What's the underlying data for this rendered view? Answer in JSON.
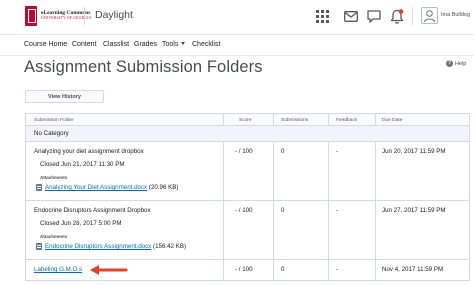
{
  "header": {
    "logo_line1": "eLearning Commons",
    "logo_line2": "UNIVERSITY OF GEORGIA",
    "org_title": "Daylight",
    "user_name": "Ima Bulldog",
    "icons": [
      "apps-grid-icon",
      "mail-icon",
      "chat-icon",
      "bell-icon",
      "user-avatar"
    ]
  },
  "nav": {
    "items": [
      "Course Home",
      "Content",
      "Classlist",
      "Grades",
      "Tools",
      "Checklist"
    ]
  },
  "page": {
    "title": "Assignment Submission Folders",
    "help_label": "Help",
    "view_history_label": "View History"
  },
  "table": {
    "headers": [
      "Submission Folder",
      "Score",
      "Submissions",
      "Feedback",
      "Due Date"
    ],
    "category": "No Category",
    "attachments_label": "Attachments",
    "rows": [
      {
        "name": "Analyzing your diet assignment dropbox",
        "closed": "Closed Jun 21, 2017 11:30 PM",
        "attachment_name": "Analyzing Your Diet Assignment.docx",
        "attachment_size": "(20.96 KB)",
        "score": "- / 100",
        "submissions": "0",
        "feedback": "-",
        "due": "Jun 20, 2017 11:59 PM"
      },
      {
        "name": "Endocrine Disruptors Assignment Dropbox",
        "closed": "Closed Jun 28, 2017 5:00 PM",
        "attachment_name": "Endocrine Disruptors Assignment.docx",
        "attachment_size": "(156.42 KB)",
        "score": "- / 100",
        "submissions": "0",
        "feedback": "-",
        "due": "Jun 27, 2017 11:59 PM"
      },
      {
        "name": "Labeling G.M.O.s",
        "score": "- / 100",
        "submissions": "0",
        "feedback": "-",
        "due": "Nov 4, 2017 11:59 PM"
      }
    ]
  },
  "colors": {
    "brand_red": "#ba0c2f",
    "link_blue": "#006fbf",
    "arrow_red": "#e8412a"
  }
}
